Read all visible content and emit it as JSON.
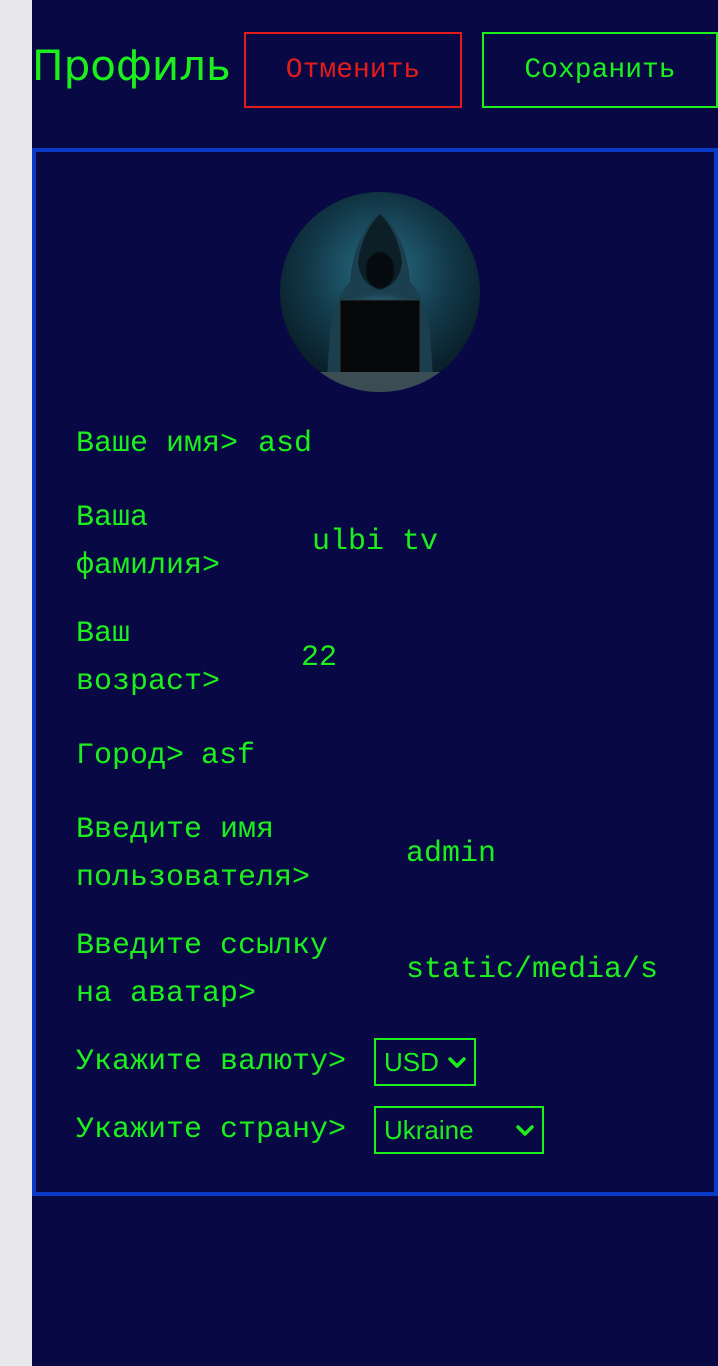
{
  "header": {
    "title": "Профиль",
    "cancel_label": "Отменить",
    "save_label": "Сохранить"
  },
  "profile": {
    "avatar_icon": "hooded-hacker-avatar",
    "fields": [
      {
        "label_line1": "Ваше имя>",
        "value": "asd"
      },
      {
        "label_line1": "Ваша",
        "label_line2": "фамилия>",
        "value": "ulbi tv"
      },
      {
        "label_line1": "Ваш",
        "label_line2": "возраст>",
        "value": "22"
      },
      {
        "label_line1": "Город>",
        "value": "asf"
      },
      {
        "label_line1": "Введите имя",
        "label_line2": "пользователя>",
        "value": "admin"
      },
      {
        "label_line1": "Введите ссылку",
        "label_line2": "на аватар>",
        "value": "static/media/s"
      }
    ],
    "currency": {
      "label": "Укажите валюту>",
      "selected": "USD"
    },
    "country": {
      "label": "Укажите страну>",
      "selected": "Ukraine"
    }
  },
  "colors": {
    "background": "#080845",
    "text": "#1cf01c",
    "cancel": "#e21b1b",
    "card_border": "#0a3bc8"
  }
}
